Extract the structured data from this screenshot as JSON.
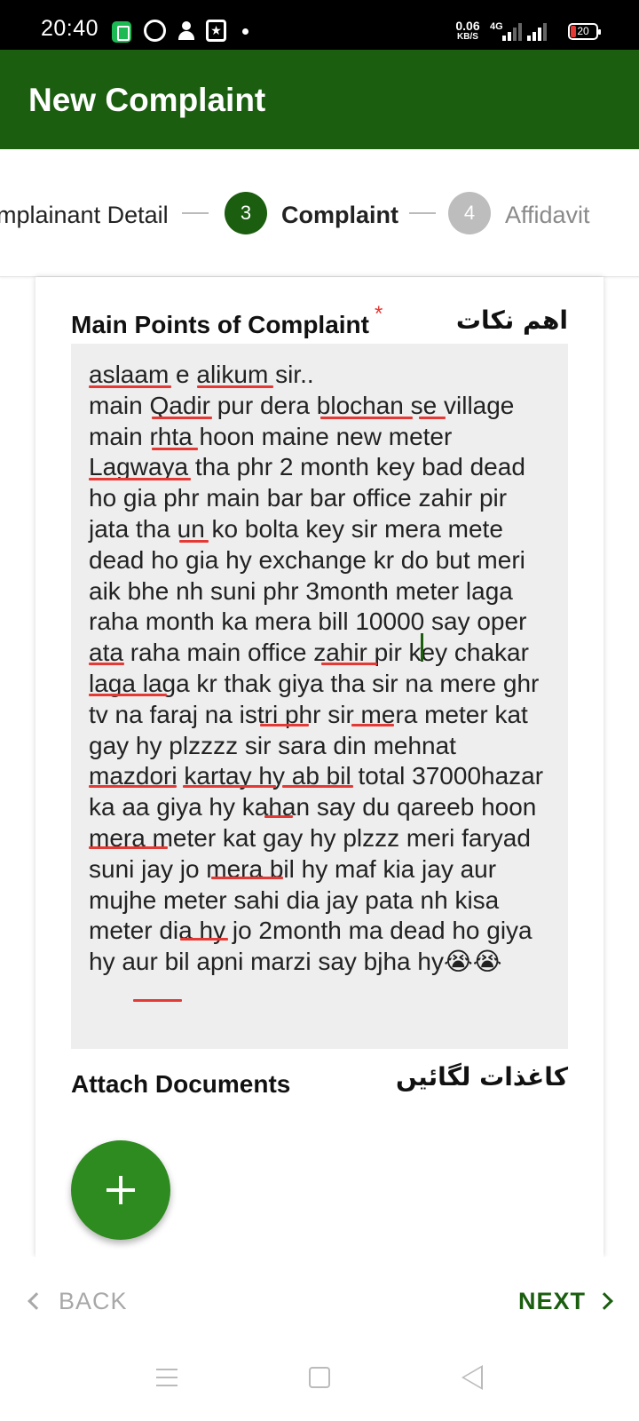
{
  "status_bar": {
    "time": "20:40",
    "net_speed_value": "0.06",
    "net_speed_unit": "KB/S",
    "network_type": "4G",
    "battery_level": "20",
    "icons": [
      "message-icon",
      "whatsapp-icon",
      "add-user-icon",
      "star-app-icon",
      "dot-icon",
      "signal-icon",
      "battery-icon"
    ]
  },
  "app_bar": {
    "title": "New Complaint"
  },
  "stepper": {
    "previous_label": "mplainant Detail",
    "active_number": "3",
    "active_label": "Complaint",
    "next_number": "4",
    "next_label": "Affidavit"
  },
  "form": {
    "points_label": "Main Points of Complaint",
    "required_mark": "*",
    "points_label_urdu": "اھم نکات",
    "complaint_text": "aslaam e alikum sir..\nmain Qadir pur dera blochan se village main rhta hoon maine new meter Lagwaya tha phr 2 month key bad dead ho gia phr main bar bar office zahir pir jata tha un ko bolta key sir mera mete dead ho gia hy exchange kr do but meri aik bhe nh suni phr 3month meter laga raha month ka mera bill 10000 say oper ata raha main office zahir pir key chakar laga laga kr thak giya tha sir na mere ghr tv na faraj na istri phr sir mera meter kat gay hy plzzzz sir sara din mehnat mazdori kartay hy ab bil total 37000hazar ka aa giya hy kahan say du qareeb hoon mera meter kat gay hy plzzz meri faryad suni jay jo mera bil hy maf kia jay aur mujhe meter sahi dia jay pata nh kisa meter dia hy jo 2month ma dead ho giya hy aur bil apni marzi say bjha hy😭😭",
    "docs_label": "Attach Documents",
    "docs_label_urdu": "کاغذات لگائیں",
    "add_button_symbol": "+"
  },
  "navigation": {
    "back_label": "BACK",
    "next_label": "NEXT"
  },
  "colors": {
    "primary": "#1b5e0f",
    "fab": "#2e8b1f",
    "required": "#e53935",
    "spellcheck": "#e53935",
    "textarea_bg": "#eeeeee"
  }
}
